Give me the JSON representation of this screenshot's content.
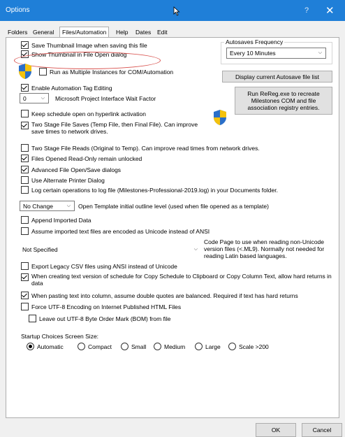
{
  "window": {
    "title": "Options",
    "help": "?",
    "close": "✕"
  },
  "tabs": [
    {
      "label": "Folders"
    },
    {
      "label": "General"
    },
    {
      "label": "Files/Automation"
    },
    {
      "label": "Help"
    },
    {
      "label": "Dates"
    },
    {
      "label": "Edit"
    }
  ],
  "opts": {
    "save_thumb": "Save Thumbnail Image when saving this file",
    "show_thumb": "Show Thumbnail in File Open dialog",
    "multi_inst": "Run as Multiple Instances for COM/Automation",
    "auto_tag": "Enable Automation Tag Editing",
    "wait_value": "0",
    "wait_label": "Microsoft Project Interface Wait Factor",
    "keep_sched": "Keep schedule open on hyperlink activation",
    "two_stage_saves": "Two Stage File Saves (Temp File, then Final File). Can improve save times to network drives.",
    "two_stage_reads": "Two Stage File Reads (Original to Temp). Can improve read times from network drives.",
    "readonly_unlocked": "Files Opened Read-Only remain unlocked",
    "adv_dialogs": "Advanced File Open/Save dialogs",
    "alt_printer": "Use Alternate Printer Dialog",
    "log_ops": "Log certain operations to log file (Milestones-Professional-2019.log) in your Documents folder.",
    "template_value": "No Change",
    "template_label": "Open Template initial outline level (used when file opened as a template)",
    "append_imported": "Append Imported Data",
    "assume_unicode": "Assume imported text files are encoded as Unicode instead of ANSI",
    "codepage_value": "Not Specified",
    "codepage_note": "Code Page to use when reading non-Unicode version files (<.ML9). Normally not needed for reading Latin based languages.",
    "export_csv": "Export Legacy CSV files using ANSI instead of Unicode",
    "copy_schedule": "When creating text version of schedule for Copy Schedule to Clipboard or Copy Column Text, allow hard returns in data",
    "pasting_text": "When pasting text into column, assume double quotes are balanced. Required if text has hard returns",
    "force_utf8": "Force UTF-8 Encoding on Internet Published HTML Files",
    "leave_bom": "Leave out UTF-8 Byte Order Mark (BOM) from file"
  },
  "autosave": {
    "legend": "Autosaves Frequency",
    "value": "Every 10 Minutes",
    "list_btn": "Display current Autosave file list",
    "rereg_btn": "Run ReReg.exe to recreate Milestones COM and file association registry entries."
  },
  "startup": {
    "label": "Startup Choices Screen Size:",
    "options": [
      {
        "label": "Automatic"
      },
      {
        "label": "Compact"
      },
      {
        "label": "Small"
      },
      {
        "label": "Medium"
      },
      {
        "label": "Large"
      },
      {
        "label": "Scale >200"
      }
    ]
  },
  "footer": {
    "ok": "OK",
    "cancel": "Cancel"
  },
  "colors": {
    "titlebar": "#1f7fd8",
    "highlight": "#d9534f",
    "shield_blue": "#2a6fc9",
    "shield_yellow": "#f4c20d"
  }
}
